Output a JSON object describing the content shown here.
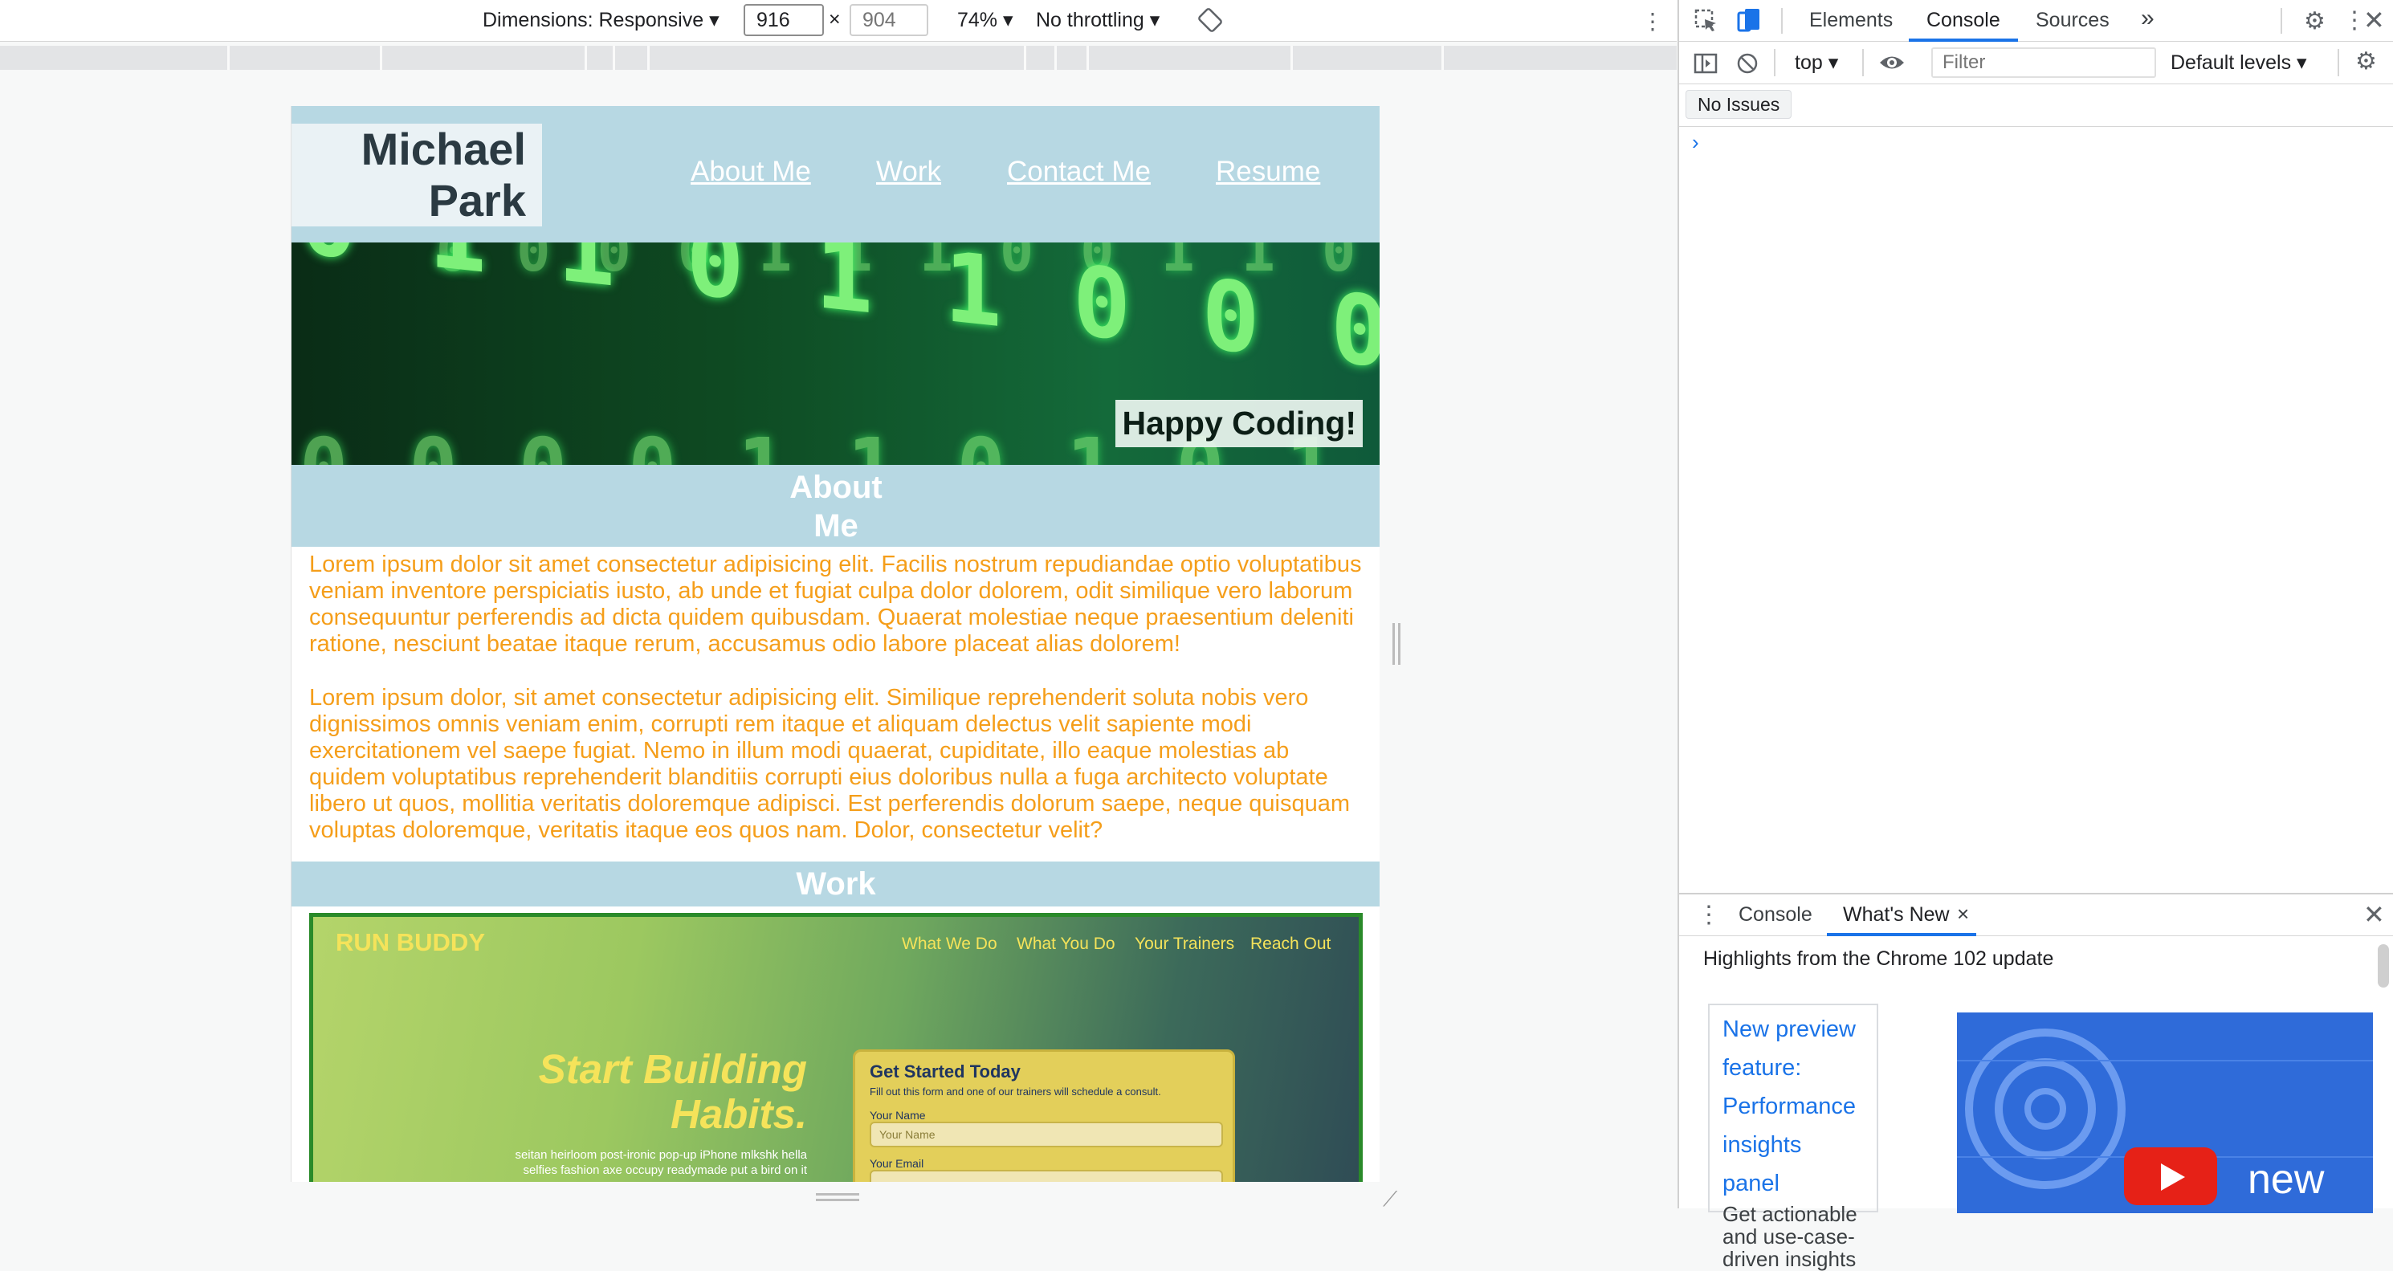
{
  "device_toolbar": {
    "dimensions_label": "Dimensions: Responsive",
    "width_value": "916",
    "height_placeholder": "904",
    "times": "×",
    "zoom": "74%",
    "throttling": "No throttling"
  },
  "site": {
    "name_line1": "Michael",
    "name_line2": "Park",
    "nav": [
      "About Me",
      "Work",
      "Contact Me",
      "Resume"
    ],
    "hero_caption": "Happy Coding!",
    "hero_binary": [
      "0 0 0 0 1 1 1 0 0 1 1 0 0 0 0 0 0 1 1 1",
      "0 1 1 0 1 1 0 0 0 1 1 0 1 0 0 0 0 1",
      "0 0 0 0 1 1 0 1 0 1 1 0 0 1 0 1 1"
    ],
    "about_heading_line1": "About",
    "about_heading_line2": "Me",
    "about_p1": "Lorem ipsum dolor sit amet consectetur adipisicing elit. Facilis nostrum repudiandae optio voluptatibus veniam inventore perspiciatis iusto, ab unde et fugiat culpa dolor dolorem, odit similique vero laborum consequuntur perferendis ad dicta quidem quibusdam. Quaerat molestiae neque praesentium deleniti ratione, nesciunt beatae itaque rerum, accusamus odio labore placeat alias dolorem!",
    "about_p2": "Lorem ipsum dolor, sit amet consectetur adipisicing elit. Similique reprehenderit soluta nobis vero dignissimos omnis veniam enim, corrupti rem itaque et aliquam delectus velit sapiente modi exercitationem vel saepe fugiat. Nemo in illum modi quaerat, cupiditate, illo eaque molestias ab quidem voluptatibus reprehenderit blanditiis corrupti eius doloribus nulla a fuga architecto voluptate libero ut quos, mollitia veritatis doloremque adipisci. Est perferendis dolorum saepe, neque quisquam voluptas doloremque, veritatis itaque eos quos nam. Dolor, consectetur velit?",
    "work_heading": "Work",
    "run_buddy": {
      "logo": "RUN BUDDY",
      "nav": [
        "What We Do",
        "What You Do",
        "Your Trainers",
        "Reach Out"
      ],
      "hero_line1": "Start Building",
      "hero_line2": "Habits.",
      "hero_sub1": "seitan heirloom post-ironic pop-up iPhone mlkshk hella",
      "hero_sub2": "selfies fashion axe occupy readymade put a bird on it",
      "form_title": "Get Started Today",
      "form_sub": "Fill out this form and one of our trainers will schedule a consult.",
      "name_label": "Your Name",
      "name_placeholder": "Your Name",
      "email_label": "Your Email"
    }
  },
  "devtools": {
    "tabs": [
      "Elements",
      "Console",
      "Sources"
    ],
    "more_tabs": "»",
    "context": "top",
    "filter_placeholder": "Filter",
    "levels": "Default levels",
    "no_issues": "No Issues",
    "prompt": "›",
    "drawer_tabs": [
      "Console",
      "What's New"
    ],
    "drawer_close": "×",
    "highlights": "Highlights from the Chrome 102 update",
    "whats_new_link": "New preview feature: Performance insights panel",
    "whats_new_desc": "Get actionable and use-case-driven insights",
    "video_word": "new"
  },
  "colors": {
    "header_bg": "#b7d8e3",
    "paragraph": "#f59e1a",
    "accent_blue": "#1a73e8"
  }
}
